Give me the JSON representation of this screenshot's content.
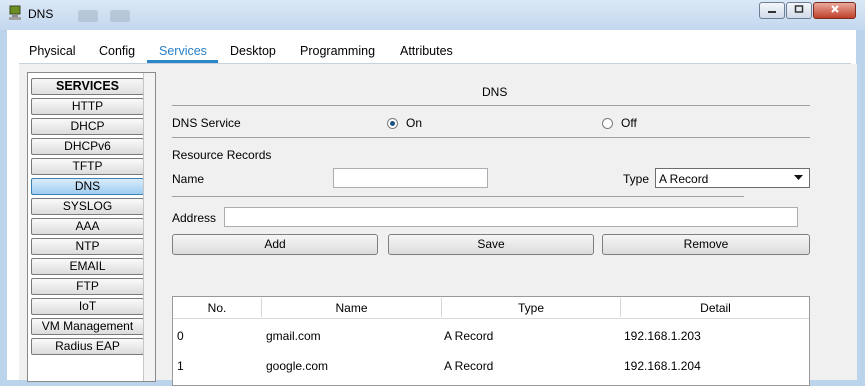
{
  "window": {
    "title": "DNS"
  },
  "tabs": [
    {
      "label": "Physical"
    },
    {
      "label": "Config"
    },
    {
      "label": "Services"
    },
    {
      "label": "Desktop"
    },
    {
      "label": "Programming"
    },
    {
      "label": "Attributes"
    }
  ],
  "sidebar": {
    "header": "SERVICES",
    "items": [
      {
        "label": "HTTP"
      },
      {
        "label": "DHCP"
      },
      {
        "label": "DHCPv6"
      },
      {
        "label": "TFTP"
      },
      {
        "label": "DNS"
      },
      {
        "label": "SYSLOG"
      },
      {
        "label": "AAA"
      },
      {
        "label": "NTP"
      },
      {
        "label": "EMAIL"
      },
      {
        "label": "FTP"
      },
      {
        "label": "IoT"
      },
      {
        "label": "VM Management"
      },
      {
        "label": "Radius EAP"
      }
    ]
  },
  "dns": {
    "heading": "DNS",
    "service_label": "DNS Service",
    "on_label": "On",
    "off_label": "Off",
    "resource_records_label": "Resource Records",
    "name_label": "Name",
    "name_value": "",
    "type_label": "Type",
    "type_value": "A Record",
    "address_label": "Address",
    "address_value": "",
    "add_button": "Add",
    "save_button": "Save",
    "remove_button": "Remove"
  },
  "records_table": {
    "headers": [
      "No.",
      "Name",
      "Type",
      "Detail"
    ],
    "rows": [
      {
        "no": "0",
        "name": "gmail.com",
        "type": "A Record",
        "detail": "192.168.1.203"
      },
      {
        "no": "1",
        "name": "google.com",
        "type": "A Record",
        "detail": "192.168.1.204"
      }
    ]
  }
}
